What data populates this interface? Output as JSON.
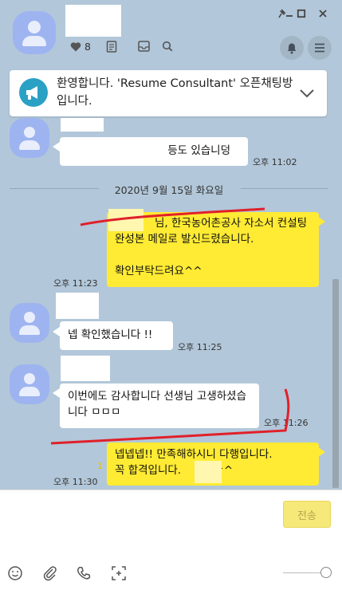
{
  "header": {
    "friends_count": "8",
    "icons": [
      "heart-icon",
      "notepad-icon",
      "inbox-icon",
      "search-icon",
      "bell-icon",
      "menu-icon"
    ],
    "window_controls": [
      "pin-icon",
      "minimize-icon",
      "maximize-icon",
      "close-icon"
    ]
  },
  "notice": {
    "text": "환영합니다. 'Resume Consultant' 오픈채팅방입니다.",
    "icon": "megaphone-icon"
  },
  "messages": [
    {
      "text": "등도 있습니덩",
      "time": "오후 11:02"
    },
    {
      "text": "님, 한국농어촌공사 자소서 컨설팅 완성본 메일로 발신드렸습니다.\n\n확인부탁드려요^^",
      "time": "오후 11:23"
    },
    {
      "text": "넵 확인했습니다 !!",
      "time": "오후 11:25"
    },
    {
      "text": "이번에도 감사합니다 선생님 고생하셨습니다 ㅁㅁㅁ",
      "time": "오후 11:26"
    },
    {
      "text": "넵넵넵!! 만족해하시니 다행입니다.\n꼭 합격입니다.       님^^",
      "time": "오후 11:30"
    }
  ],
  "date_divider": "2020년 9월 15일 화요일",
  "input": {
    "send_label": "전송",
    "placeholder": ""
  },
  "toolbar_icons": [
    "emoji-icon",
    "attachment-icon",
    "phone-icon",
    "capture-icon"
  ],
  "colors": {
    "chat_bg": "#b2c7d9",
    "my_bubble": "#ffeb33",
    "other_bubble": "#ffffff",
    "annotation_red": "#e0202a"
  }
}
